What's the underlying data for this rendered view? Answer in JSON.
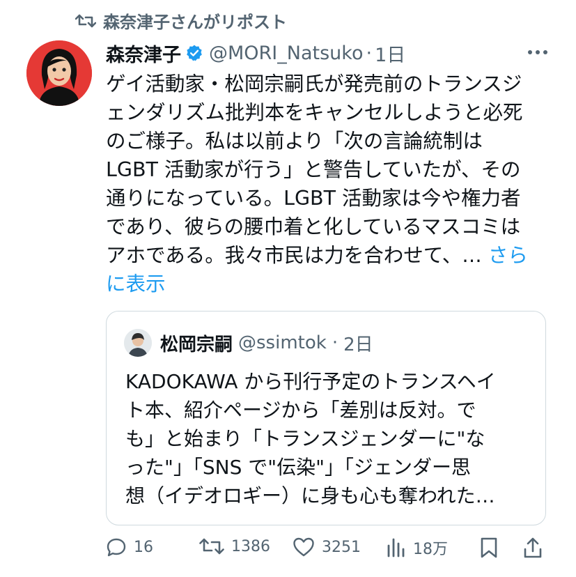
{
  "repost": {
    "text": "森奈津子さんがリポスト"
  },
  "tweet": {
    "name": "森奈津子",
    "handle": "@MORI_Natsuko",
    "sep": "·",
    "time": "1日",
    "text_lines": [
      "ゲイ活動家・松岡宗嗣氏が発売前のトランスジ",
      "ェンダリズム批判本をキャンセルしようと必死",
      "のご様子。私は以前より「次の言論統制は",
      "LGBT 活動家が行う」と警告していたが、その",
      "通りになっている。LGBT 活動家は今や権力者",
      "であり、彼らの腰巾着と化しているマスコミは",
      "アホである。我々市民は力を合わせて、… "
    ],
    "show_more_1": "さら",
    "show_more_2": "に表示"
  },
  "quote": {
    "name": "松岡宗嗣",
    "handle": "@ssimtok",
    "sep": "·",
    "time": "2日",
    "text_lines": [
      "KADOKAWA から刊行予定のトランスヘイ",
      "ト本、紹介ページから「差別は反対。で",
      "も」と始まり「トランスジェンダーに\"な",
      "った\"」「SNS で\"伝染\"」「ジェンダー思",
      "想（イデオロギー）に身も心も奪われた…"
    ]
  },
  "actions": {
    "replies": "16",
    "reposts": "1386",
    "likes": "3251",
    "views": "18万"
  },
  "colors": {
    "accent": "#1d9bf0",
    "muted": "#536471",
    "avatar_bg": "#e53935"
  }
}
